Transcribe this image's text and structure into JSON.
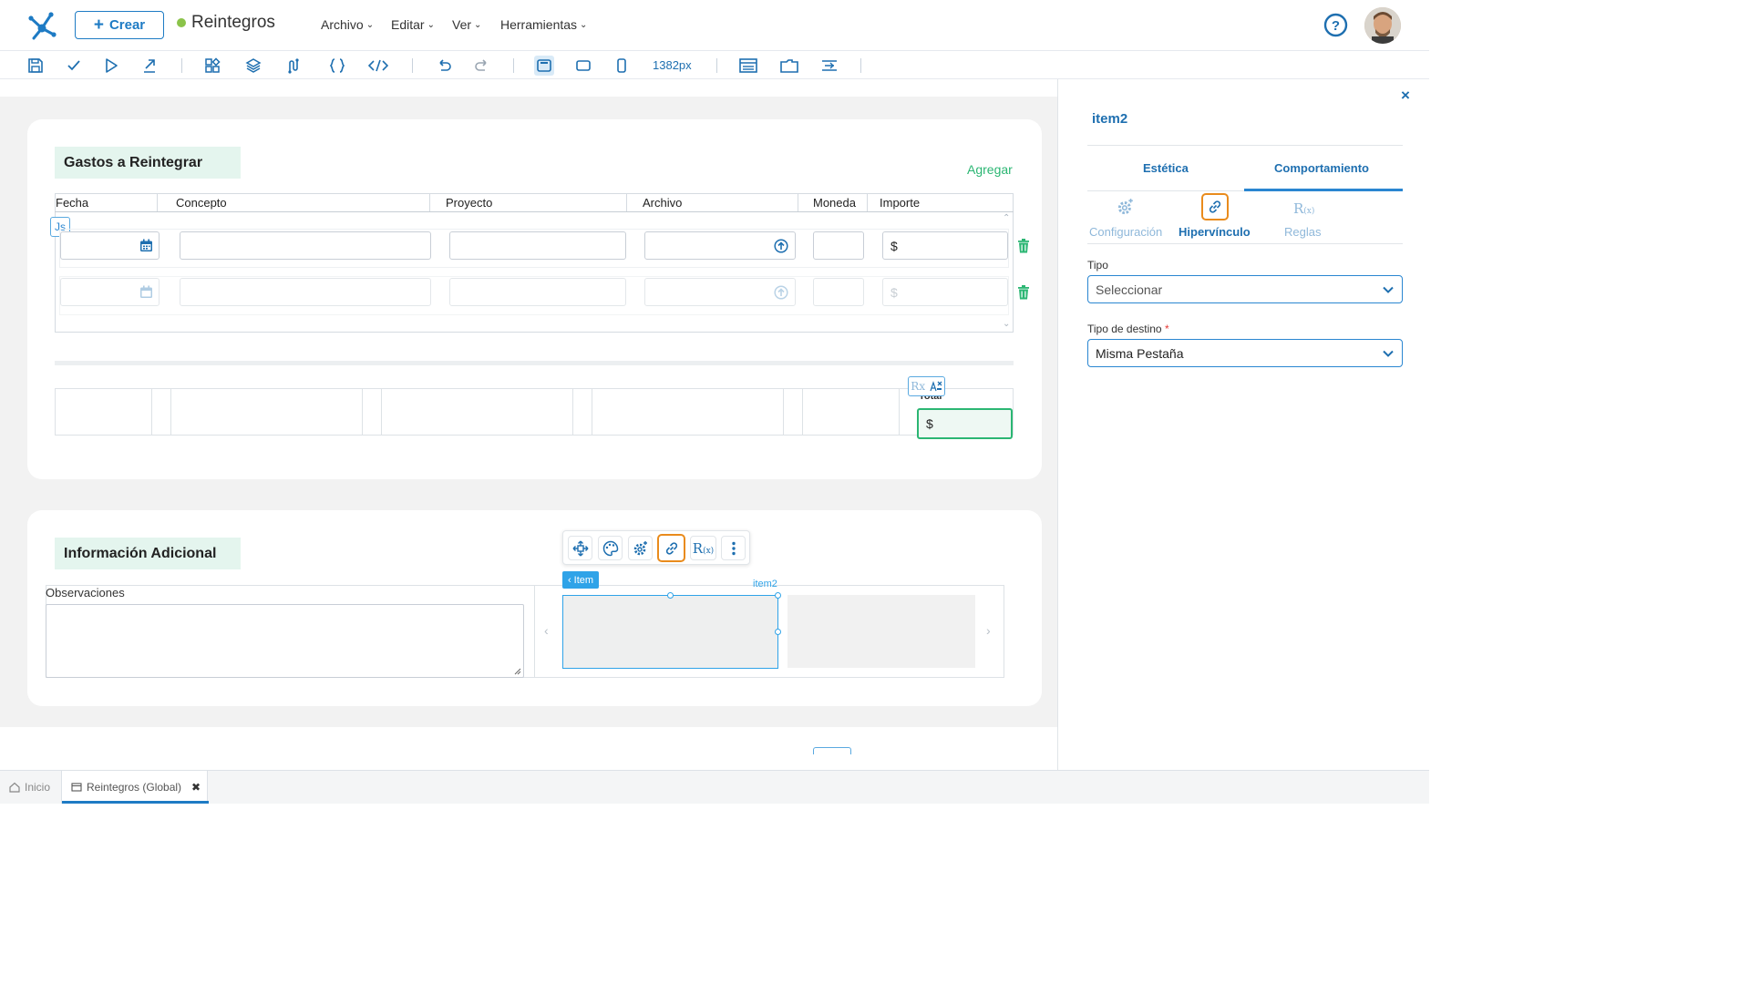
{
  "header": {
    "create_label": "Crear",
    "app_title": "Reintegros",
    "menus": [
      "Archivo",
      "Editar",
      "Ver",
      "Herramientas"
    ]
  },
  "toolbar": {
    "width_label": "1382px"
  },
  "gastos": {
    "title": "Gastos a Reintegrar",
    "add_label": "Agregar",
    "columns": [
      "Fecha",
      "Concepto",
      "Proyecto",
      "Archivo",
      "Moneda",
      "Importe"
    ],
    "js_badge": "Js",
    "currency_symbol": "$",
    "total_label": "Total",
    "rx_label": "Rx"
  },
  "info": {
    "title": "Información Adicional",
    "observaciones_label": "Observaciones",
    "item_tag": "Item",
    "item2_label": "item2"
  },
  "panel": {
    "item_name": "item2",
    "tabs": [
      "Estética",
      "Comportamiento"
    ],
    "sub_tabs": [
      "Configuración",
      "Hipervínculo",
      "Reglas"
    ],
    "tipo_label": "Tipo",
    "tipo_value": "Seleccionar",
    "destino_label": "Tipo de destino",
    "destino_required": "*",
    "destino_value": "Misma Pestaña",
    "close_label": "×"
  },
  "bottom_tabs": [
    {
      "label": "Inicio",
      "active": false
    },
    {
      "label": "Reintegros (Global)",
      "active": true,
      "close": "✖"
    }
  ],
  "colors": {
    "primary": "#1e6fb0",
    "accent_green": "#2bb673",
    "highlight_orange": "#e98b1c",
    "section_bg": "#e4f5ee"
  }
}
